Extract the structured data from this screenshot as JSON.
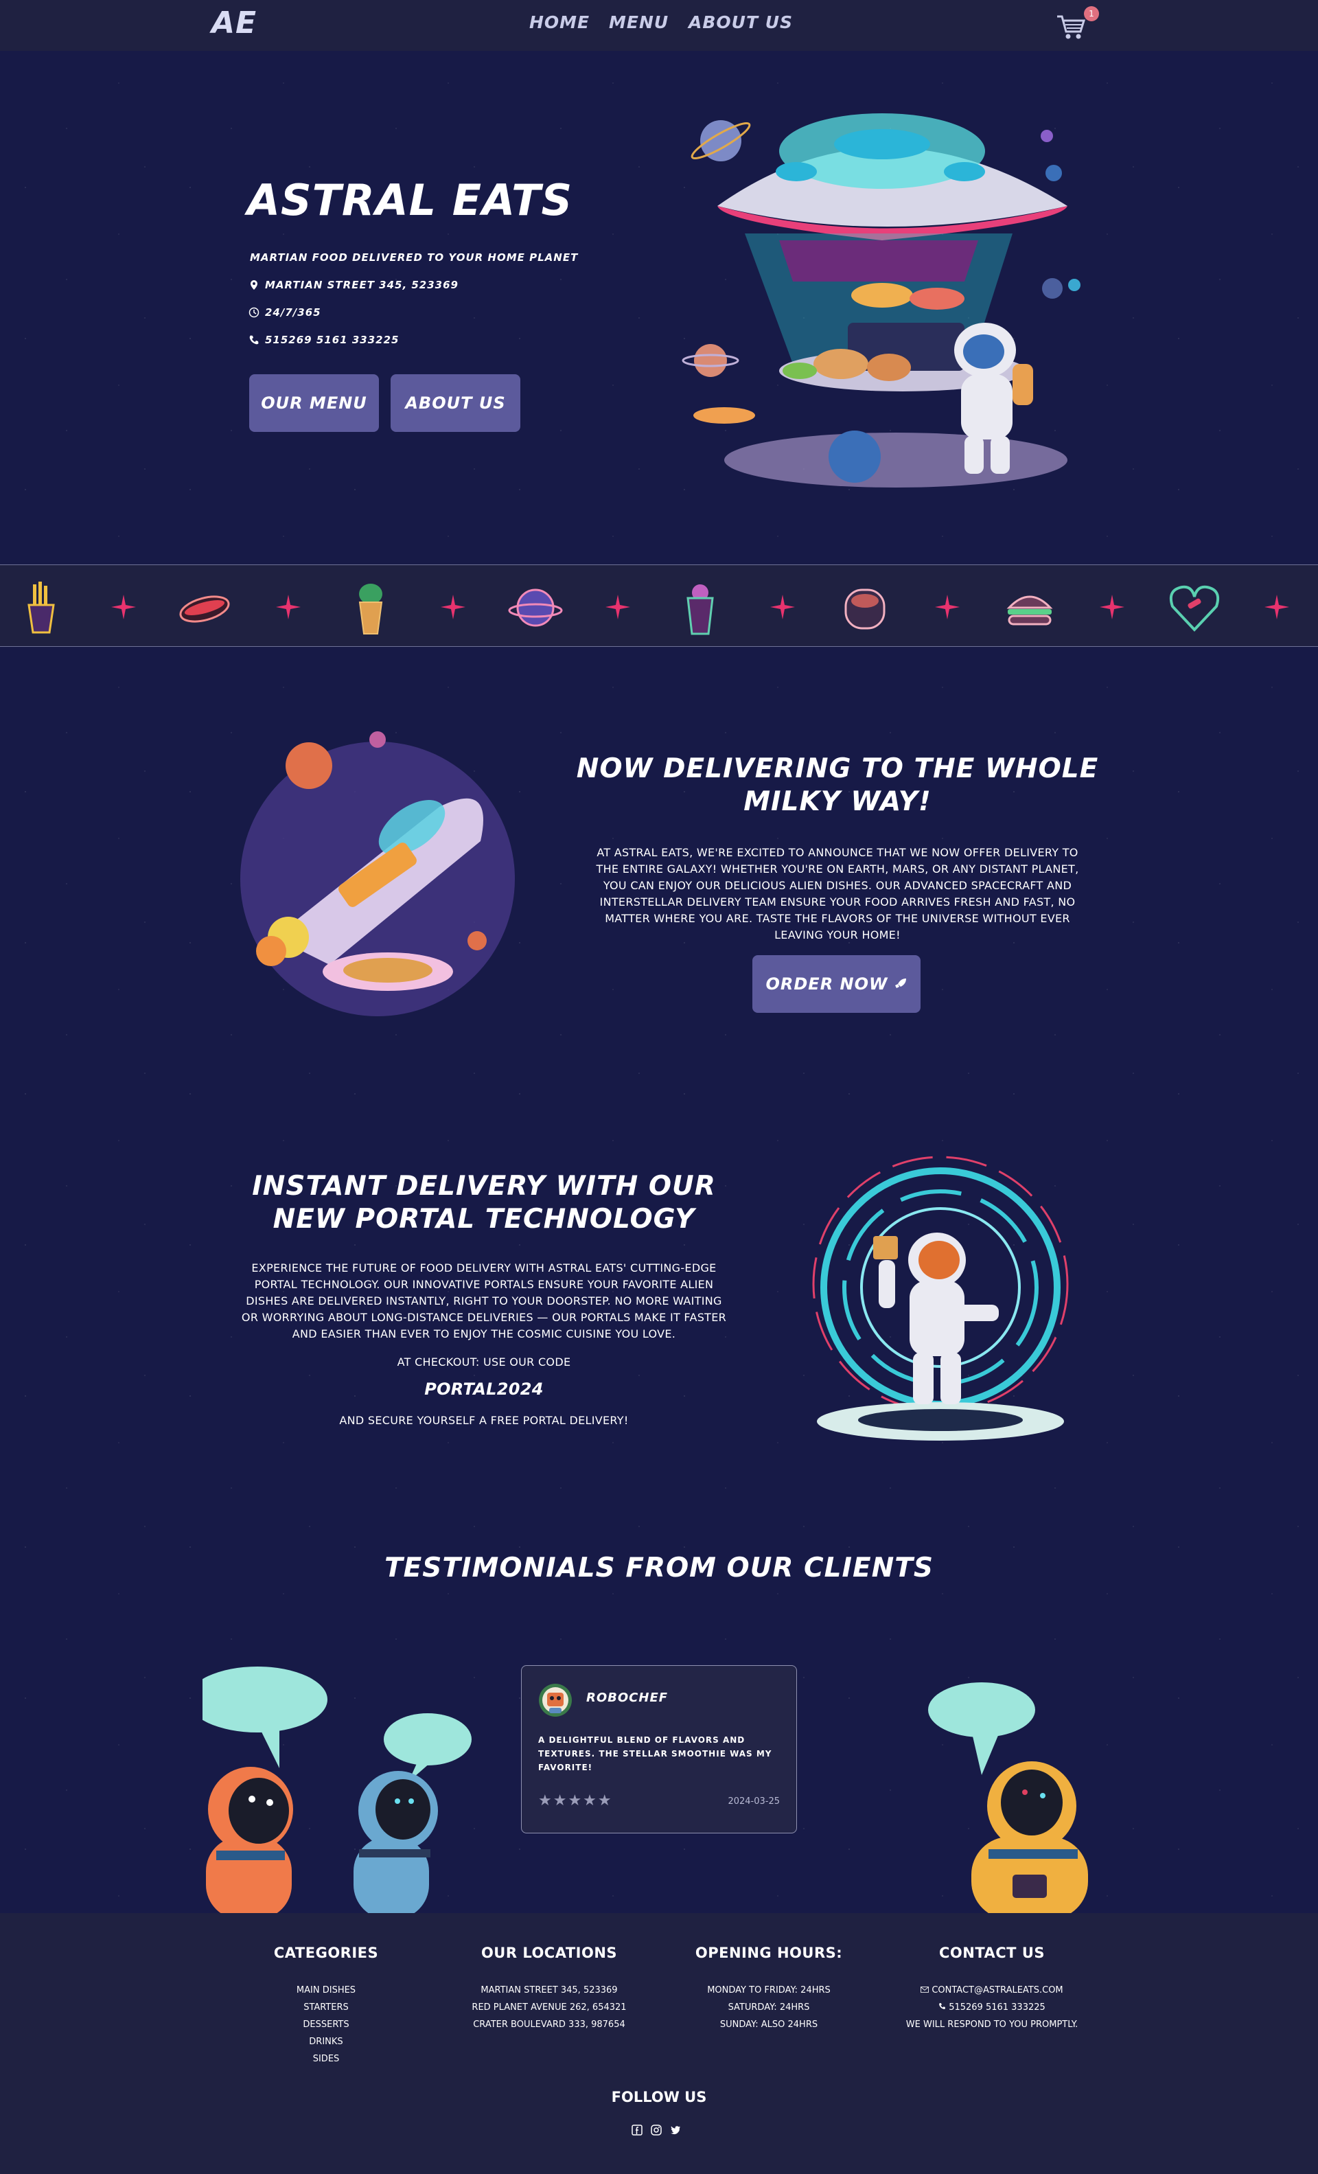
{
  "header": {
    "logo": "AE",
    "nav": [
      "HOME",
      "MENU",
      "ABOUT US"
    ],
    "cart_count": "1"
  },
  "hero": {
    "title": "ASTRAL EATS",
    "tagline": "MARTIAN FOOD DELIVERED TO YOUR HOME PLANET",
    "address": "MARTIAN STREET 345, 523369",
    "hours": "24/7/365",
    "phone": "515269 5161 333225",
    "btn_menu": "OUR MENU",
    "btn_about": "ABOUT US"
  },
  "strip": {
    "items": [
      "fries-icon",
      "hotdog-icon",
      "cactus-cup-icon",
      "planet-icon",
      "smoothie-icon",
      "bowl-icon",
      "burger-icon",
      "heart-icon"
    ]
  },
  "delivery": {
    "title_line1": "NOW DELIVERING TO THE WHOLE",
    "title_line2": "MILKY WAY!",
    "body": [
      "AT ASTRAL EATS, WE'RE EXCITED TO ANNOUNCE THAT WE NOW OFFER DELIVERY TO",
      "THE ENTIRE GALAXY! WHETHER YOU'RE ON EARTH, MARS, OR ANY DISTANT PLANET,",
      "YOU CAN ENJOY OUR DELICIOUS ALIEN DISHES. OUR ADVANCED SPACECRAFT AND",
      "INTERSTELLAR DELIVERY TEAM ENSURE YOUR FOOD ARRIVES FRESH AND FAST, NO",
      "MATTER WHERE YOU ARE. TASTE THE FLAVORS OF THE UNIVERSE WITHOUT EVER",
      "LEAVING YOUR HOME!"
    ],
    "button": "ORDER NOW"
  },
  "portal": {
    "title_line1": "INSTANT DELIVERY WITH OUR",
    "title_line2": "NEW PORTAL TECHNOLOGY",
    "body": [
      "EXPERIENCE THE FUTURE OF FOOD DELIVERY WITH ASTRAL EATS' CUTTING-EDGE",
      "PORTAL TECHNOLOGY. OUR INNOVATIVE PORTALS ENSURE YOUR FAVORITE ALIEN",
      "DISHES ARE DELIVERED INSTANTLY, RIGHT TO YOUR DOORSTEP. NO MORE WAITING",
      "OR WORRYING ABOUT LONG-DISTANCE DELIVERIES — OUR PORTALS MAKE IT FASTER",
      "AND EASIER THAN EVER TO ENJOY THE COSMIC CUISINE YOU LOVE."
    ],
    "checkout_text": "AT CHECKOUT: USE OUR CODE",
    "code": "PORTAL2024",
    "after_text": "AND SECURE YOURSELF A FREE PORTAL DELIVERY!"
  },
  "testimonials": {
    "title": "TESTIMONIALS FROM OUR CLIENTS",
    "card": {
      "name": "ROBOCHEF",
      "text_line1": "A DELIGHTFUL BLEND OF FLAVORS AND",
      "text_line2": "TEXTURES. THE STELLAR SMOOTHIE WAS MY",
      "text_line3": "FAVORITE!",
      "stars": "★★★★★",
      "date": "2024-03-25"
    }
  },
  "footer": {
    "categories": {
      "title": "CATEGORIES",
      "items": [
        "MAIN DISHES",
        "STARTERS",
        "DESSERTS",
        "DRINKS",
        "SIDES"
      ]
    },
    "locations": {
      "title": "OUR LOCATIONS",
      "items": [
        "MARTIAN STREET 345, 523369",
        "RED PLANET AVENUE 262, 654321",
        "CRATER BOULEVARD 333, 987654"
      ]
    },
    "hours": {
      "title": "OPENING HOURS:",
      "items": [
        "MONDAY TO FRIDAY: 24HRS",
        "SATURDAY: 24HRS",
        "SUNDAY: ALSO 24HRS"
      ]
    },
    "contact": {
      "title": "CONTACT US",
      "email": "CONTACT@ASTRALEATS.COM",
      "phone": "515269 5161 333225",
      "note": "WE WILL RESPOND TO YOU PROMPTLY."
    },
    "follow_title": "FOLLOW US"
  },
  "colors": {
    "background": "#171a47",
    "bar": "#1f2141",
    "button": "#5c5a9c",
    "accent_pink": "#e8336e",
    "accent_teal": "#9ee6dc"
  }
}
